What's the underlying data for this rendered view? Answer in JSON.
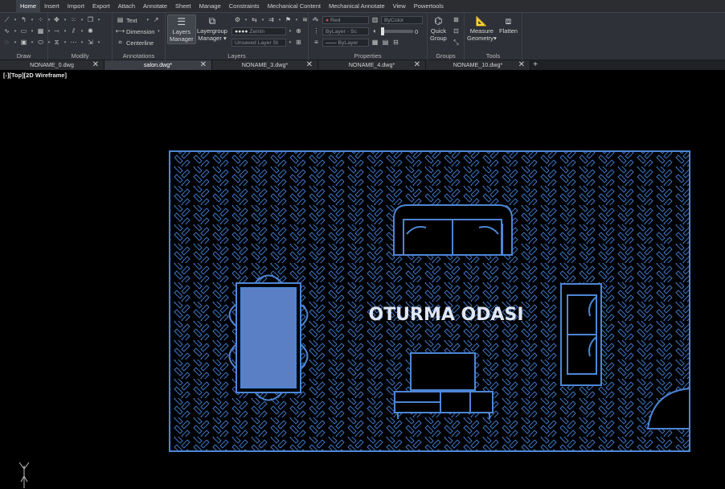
{
  "menu": {
    "items": [
      "Home",
      "Insert",
      "Import",
      "Export",
      "Attach",
      "Annotate",
      "Sheet",
      "Manage",
      "Constraints",
      "Mechanical Content",
      "Mechanical Annotate",
      "View",
      "Powertools"
    ],
    "active": "Home"
  },
  "ribbon": {
    "groups": {
      "draw": "Draw",
      "modify": "Modify",
      "annotations": "Annotations",
      "layers": "Layers",
      "properties": "Properties",
      "groups": "Groups",
      "tools": "Tools"
    },
    "annotations": {
      "text": "Text",
      "dimension": "Dimension",
      "centerline": "Centerline"
    },
    "layers": {
      "manager_line1": "Layers",
      "manager_line2": "Manager",
      "layergroup_line1": "Layergroup",
      "layergroup_line2": "Manager",
      "current_layer": "Zemin",
      "unsaved_state": "Unsaved Layer St"
    },
    "properties": {
      "color": "Red",
      "bycolor": "ByColor",
      "linetype": "ByLayer",
      "linetype_suffix": "Sc",
      "lineweight": "ByLayer",
      "transparency": "0"
    },
    "groups_panel": {
      "quick_group_line1": "Quick",
      "quick_group_line2": "Group"
    },
    "tools": {
      "measure_line1": "Measure",
      "measure_line2": "Geometry",
      "flatten": "Flatten"
    }
  },
  "tabs": [
    {
      "name": "NONAME_0.dwg",
      "active": false
    },
    {
      "name": "salon.dwg*",
      "active": true
    },
    {
      "name": "NONAME_3.dwg*",
      "active": false
    },
    {
      "name": "NONAME_4.dwg*",
      "active": false
    },
    {
      "name": "NONAME_10.dwg*",
      "active": false
    }
  ],
  "viewport": {
    "label": "[-][Top][2D Wireframe]",
    "room_label": "OTURMA ODASI"
  },
  "colors": {
    "cad_blue": "#3f78c8",
    "table_fill": "#5b7fc4",
    "ribbon_bg": "#2e3137",
    "menubar_bg": "#2b2d31"
  },
  "icons": {
    "tab_close": "✕",
    "tab_add": "+"
  }
}
